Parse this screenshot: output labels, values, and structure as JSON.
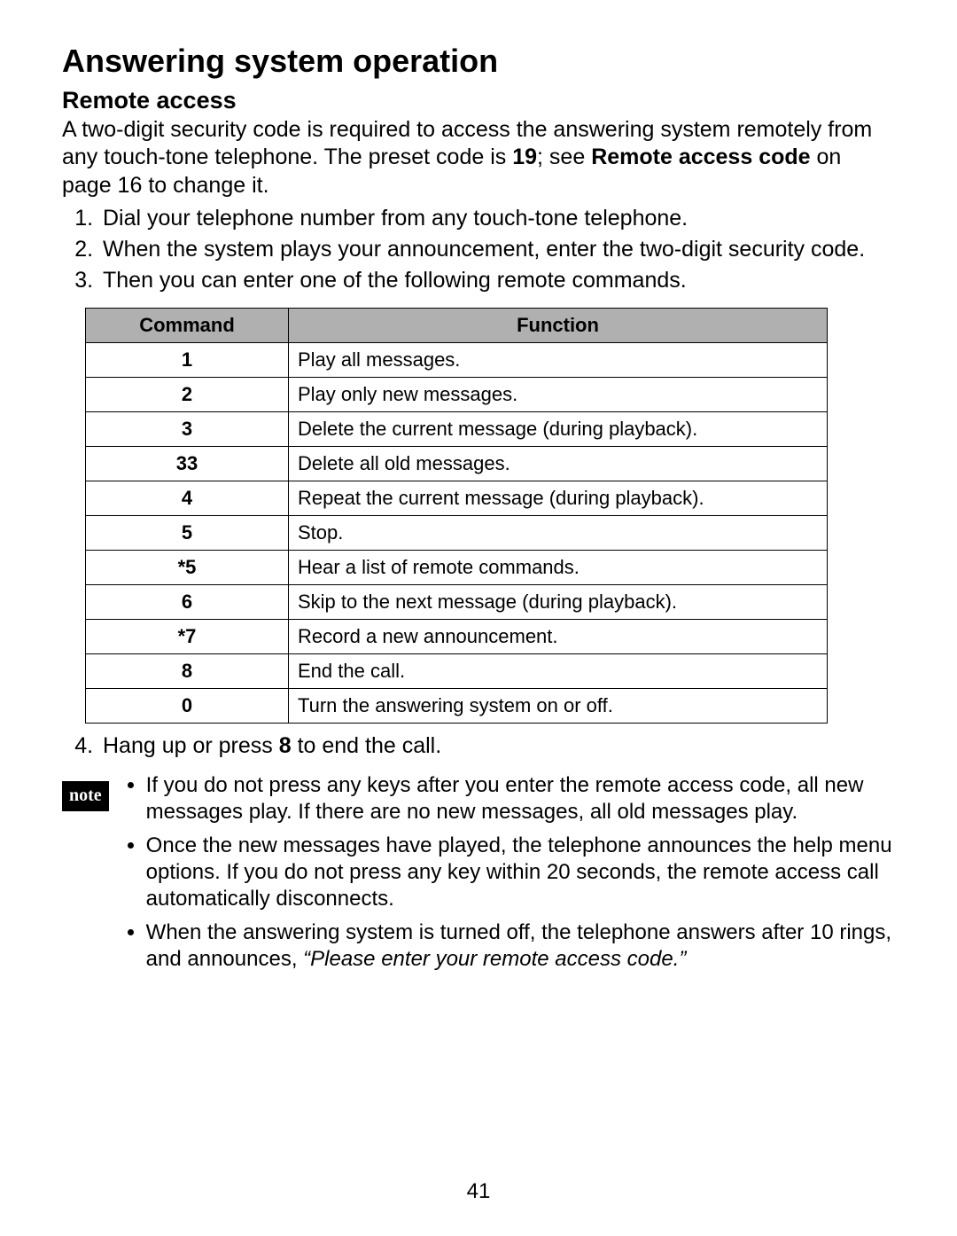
{
  "title": "Answering system operation",
  "subtitle": "Remote access",
  "intro_pre": "A two-digit security code is required to access the answering system remotely from any touch-tone telephone. The preset code is ",
  "preset_code": "19",
  "intro_mid": "; see ",
  "intro_link": "Remote access code",
  "intro_post": " on page 16 to change it.",
  "steps": [
    "Dial your telephone number from any touch-tone telephone.",
    "When the system plays your announcement, enter the two-digit security code.",
    "Then you can enter one of the following remote commands."
  ],
  "table": {
    "headers": [
      "Command",
      "Function"
    ],
    "rows": [
      {
        "cmd": "1",
        "fn": "Play all messages."
      },
      {
        "cmd": "2",
        "fn": "Play only new messages."
      },
      {
        "cmd": "3",
        "fn": "Delete the current message (during playback)."
      },
      {
        "cmd": "33",
        "fn": "Delete all old messages."
      },
      {
        "cmd": "4",
        "fn": "Repeat the current message (during playback)."
      },
      {
        "cmd": "5",
        "fn": "Stop."
      },
      {
        "cmd": "*5",
        "fn": "Hear a list of remote commands."
      },
      {
        "cmd": "6",
        "fn": "Skip to the next message (during playback)."
      },
      {
        "cmd": "*7",
        "fn": "Record a new announcement."
      },
      {
        "cmd": "8",
        "fn": "End the call."
      },
      {
        "cmd": "0",
        "fn": "Turn the answering system on or off."
      }
    ]
  },
  "step4_pre": "Hang up or press ",
  "step4_key": "8",
  "step4_post": " to end the call.",
  "note_label": "note",
  "notes": [
    {
      "text": "If you do not press any keys after you enter the remote access code, all new messages play. If there are no new messages, all old messages play."
    },
    {
      "text": "Once the new messages have played, the telephone announces the help menu options. If you do not press any key within 20 seconds, the remote access call automatically disconnects."
    },
    {
      "pre": "When the answering system is turned off, the telephone answers after 10 rings, and announces, ",
      "quote": "“Please enter your remote access code.”"
    }
  ],
  "page_number": "41"
}
